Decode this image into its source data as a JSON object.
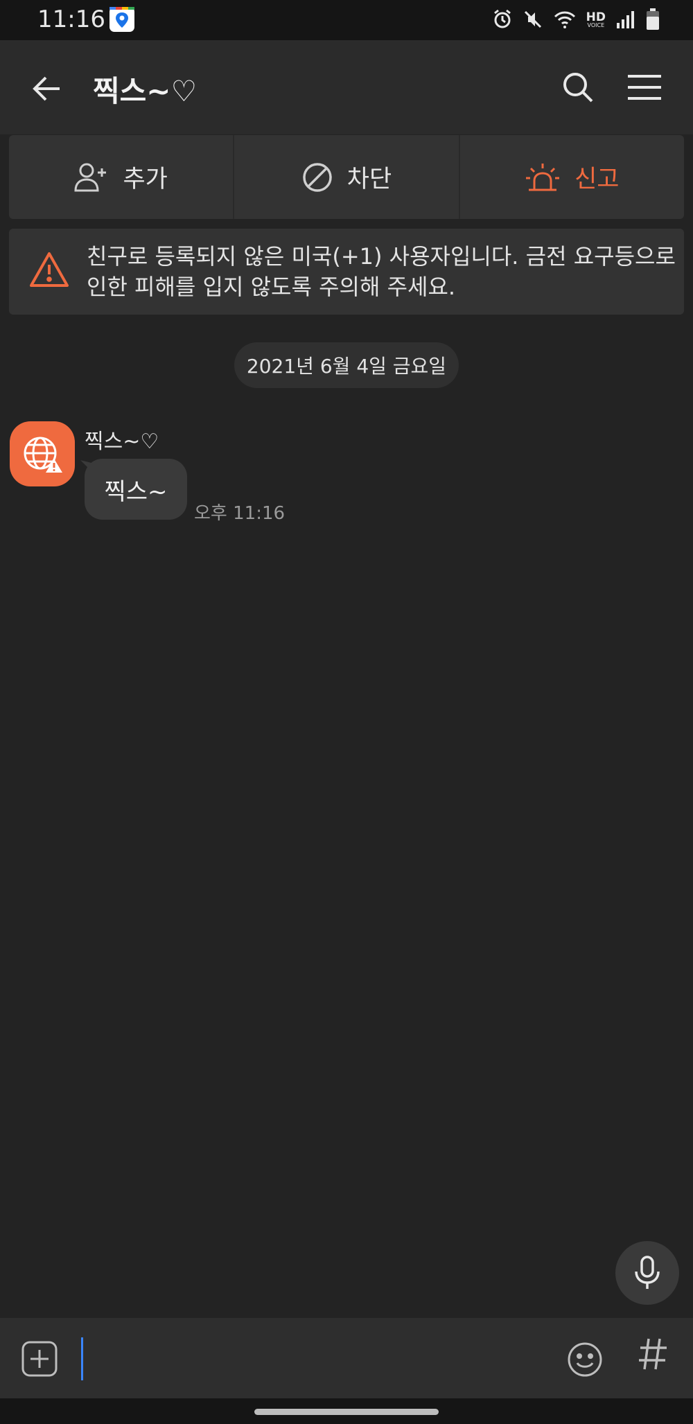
{
  "status_bar": {
    "time": "11:16",
    "icons": [
      "map-pin-app-icon",
      "alarm-icon",
      "mute-icon",
      "wifi-icon",
      "hd-voice-icon",
      "signal-icon",
      "battery-icon"
    ],
    "hd_label": "HD",
    "voice_label": "VOICE"
  },
  "header": {
    "title": "찍스~♡",
    "icons": [
      "back-arrow-icon",
      "search-icon",
      "menu-icon"
    ]
  },
  "actions": {
    "add_label": "추가",
    "block_label": "차단",
    "report_label": "신고"
  },
  "warning": {
    "text": "친구로 등록되지 않은 미국(+1) 사용자입니다. 금전 요구등으로 인한 피해를 입지 않도록 주의해 주세요."
  },
  "chat": {
    "date_separator": "2021년 6월 4일 금요일",
    "messages": [
      {
        "sender": "찍스~♡",
        "text": "찍스~",
        "time": "오후 11:16"
      }
    ]
  },
  "input": {
    "value": "",
    "placeholder": ""
  },
  "colors": {
    "accent": "#ef6a3f",
    "background": "#232323",
    "header": "#2b2b2b",
    "bubble": "#3a3a3a",
    "cursor": "#3a86ff"
  }
}
